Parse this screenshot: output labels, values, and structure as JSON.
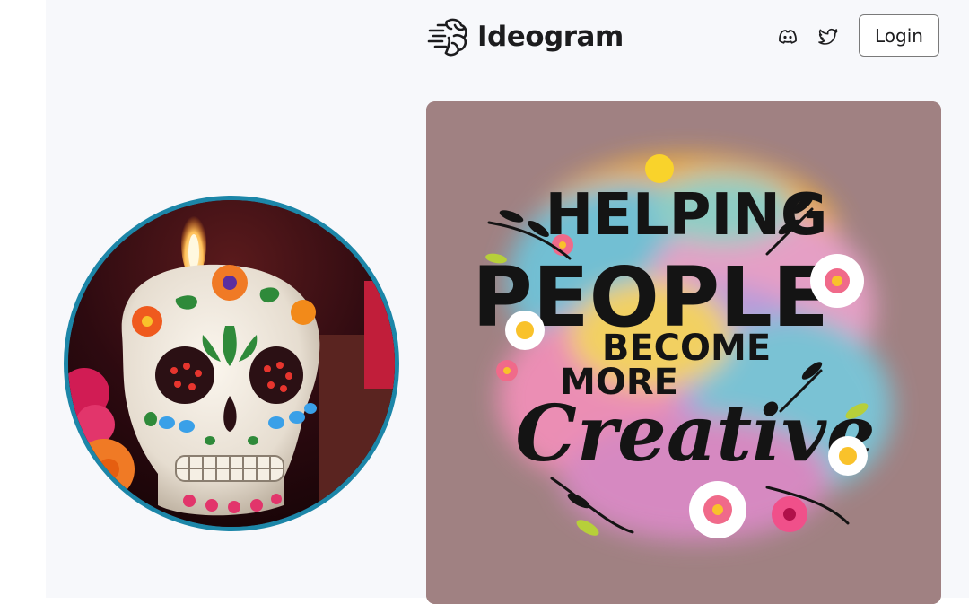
{
  "header": {
    "brand": "Ideogram",
    "login_label": "Login",
    "social_icons": [
      "discord-icon",
      "twitter-icon"
    ]
  },
  "profile": {
    "avatar_description_icon": "sugar-skull-candle-image"
  },
  "featured_image": {
    "lines": [
      "HELPING",
      "PEOPLE",
      "BECOME",
      "MORE",
      "Creative"
    ]
  },
  "colors": {
    "page_background": "#f7f8fb",
    "avatar_ring": "#1c86a8",
    "featured_background": "#a08182",
    "text_dark": "#1c1c1e"
  }
}
